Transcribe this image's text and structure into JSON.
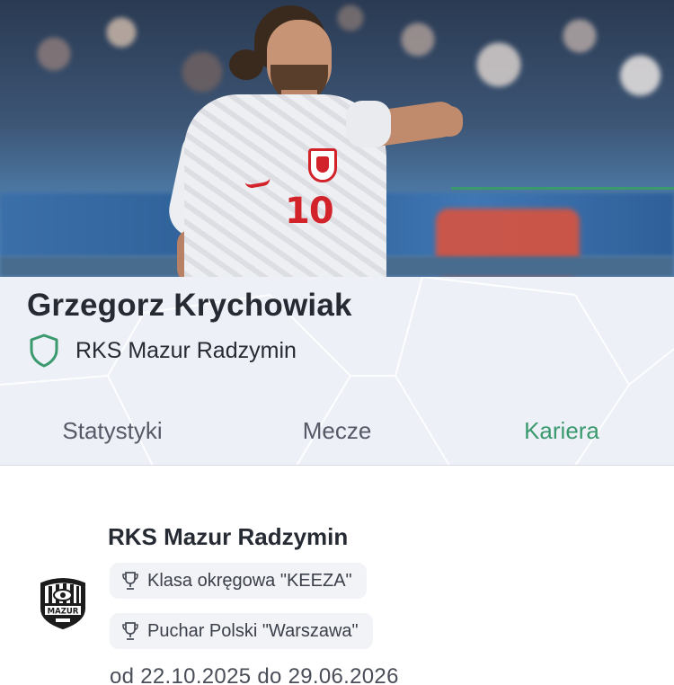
{
  "player": {
    "name": "Grzegorz Krychowiak",
    "shirt_number": "10",
    "club": "RKS Mazur Radzymin",
    "club_icon": "shield-icon"
  },
  "tabs": [
    {
      "label": "Statystyki",
      "active": false
    },
    {
      "label": "Mecze",
      "active": false
    },
    {
      "label": "Kariera",
      "active": true
    }
  ],
  "career": {
    "club": "RKS Mazur Radzymin",
    "logo_text": "MAZUR",
    "competitions": [
      {
        "icon": "trophy-icon",
        "label": "Klasa okręgowa \"KEEZA\""
      },
      {
        "icon": "trophy-icon",
        "label": "Puchar Polski \"Warszawa\""
      }
    ],
    "period": "od 22.10.2025 do 29.06.2026"
  },
  "colors": {
    "accent": "#3a9a6e",
    "header_bg": "#eef0f8",
    "text": "#262a33"
  }
}
